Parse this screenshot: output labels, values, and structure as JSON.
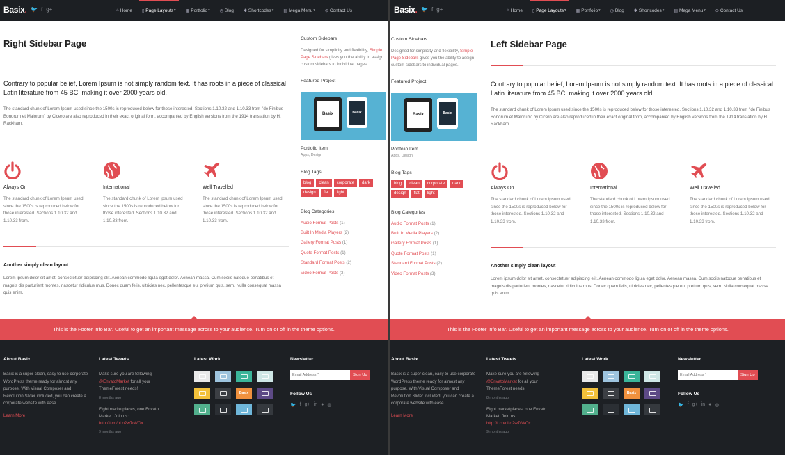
{
  "colors": {
    "accent": "#e14d53",
    "nav_bg": "#1c1f23",
    "footer_bg": "#1d2024",
    "project_bg": "#56b2d3"
  },
  "header": {
    "logo": "Basix",
    "logo_dot": ".",
    "social_icons": [
      "twitter-icon",
      "facebook-icon",
      "google-plus-icon"
    ],
    "social_glyphs": [
      "🐦",
      "f",
      "g+"
    ],
    "nav": [
      {
        "icon": "home-icon",
        "glyph": "⌂",
        "label": "Home"
      },
      {
        "icon": "page-icon",
        "glyph": "▯",
        "label": "Page Layouts"
      },
      {
        "icon": "portfolio-icon",
        "glyph": "▦",
        "label": "Portfolio"
      },
      {
        "icon": "blog-icon",
        "glyph": "◷",
        "label": "Blog"
      },
      {
        "icon": "shortcodes-icon",
        "glyph": "✱",
        "label": "Shortcodes"
      },
      {
        "icon": "mega-menu-icon",
        "glyph": "▤",
        "label": "Mega Menu"
      },
      {
        "icon": "contact-icon",
        "glyph": "⊙",
        "label": "Contact Us"
      }
    ],
    "caret": "▾"
  },
  "pages": {
    "right": {
      "title": "Right Sidebar Page"
    },
    "left": {
      "title": "Left Sidebar Page"
    }
  },
  "content": {
    "lead": "Contrary to popular belief, Lorem Ipsum is not simply random text. It has roots in a piece of classical Latin literature from 45 BC, making it over 2000 years old.",
    "paragraph": "The standard chunk of Lorem Ipsum used since the 1500s is reproduced below for those interested. Sections 1.10.32 and 1.10.33 from \"de Finibus Bonorum et Malorum\" by Cicero are also reproduced in their exact original form, accompanied by English versions from the 1914 translation by H. Rackham.",
    "features": [
      {
        "icon": "power-icon",
        "title": "Always On",
        "text": "The standard chunk of Lorem Ipsum used since the 1500s is reproduced below for those interested. Sections 1.10.32 and 1.10.33 from."
      },
      {
        "icon": "globe-icon",
        "title": "International",
        "text": "The standard chunk of Lorem Ipsum used since the 1500s is reproduced below for those interested. Sections 1.10.32 and 1.10.33 from."
      },
      {
        "icon": "plane-icon",
        "title": "Well Travelled",
        "text": "The standard chunk of Lorem Ipsum used since the 1500s is reproduced below for those interested. Sections 1.10.32 and 1.10.33 from."
      }
    ],
    "layout_title": "Another simply clean layout",
    "layout_text": "Lorem ipsum dolor sit amet, consectetuer adipiscing elit. Aenean commodo ligula eget dolor. Aenean massa. Cum sociis natoque penatibus et magnis dis parturient montes, nascetur ridiculus mus. Donec quam felis, ultricies nec, pellentesque eu, pretium quis, sem. Nulla consequat massa quis enim."
  },
  "sidebar": {
    "custom_title": "Custom Sidebars",
    "custom_text_before": "Designed for simplicity and flexibility,",
    "custom_link": "Simple Page Sidebars",
    "custom_text_after": "gives you the ability to assign custom sidebars to individual pages.",
    "featured_title": "Featured Project",
    "project_tablet_left": "Basix",
    "project_tablet_right": "Basix",
    "project_name": "Portfolio Item",
    "project_cats": "Apps, Design",
    "tags_title": "Blog Tags",
    "tags": [
      "blog",
      "clean",
      "corporate",
      "dark",
      "design",
      "flat",
      "light"
    ],
    "categories_title": "Blog Categories",
    "categories": [
      {
        "name": "Audio Format Posts",
        "count": "(1)"
      },
      {
        "name": "Built In Media Players",
        "count": "(2)"
      },
      {
        "name": "Gallery Format Posts",
        "count": "(1)"
      },
      {
        "name": "Quote Format Posts",
        "count": "(1)"
      },
      {
        "name": "Standard Format Posts",
        "count": "(2)"
      },
      {
        "name": "Video Format Posts",
        "count": "(3)"
      }
    ]
  },
  "info_bar": "This is the Footer Info Bar. Useful to get an important message across to your audience. Turn on or off in the theme options.",
  "footer": {
    "about_title": "About Basix",
    "about_text": "Basix is a super clean, easy to use corporate WordPress theme ready for almost any purpose. With Visual Composer and Revolution Slider included, you can create a corporate website with ease.",
    "learn_more": "Learn More",
    "tweets_title": "Latest Tweets",
    "tweet1_text": "Make sure you are following",
    "tweet1_link": "@EnvatoMarket",
    "tweet1_after": "for all your ThemeForest needs!",
    "tweet1_time": "8 months ago",
    "tweet2_text": "Eight marketplaces, one Envato Market. Join us:",
    "tweet2_link": "http://t.co/oLo2w7rWOx",
    "tweet2_time": "9 months ago",
    "work_title": "Latest Work",
    "work_items": [
      {
        "icon": "red-tablet-icon",
        "color": "#e9e9e9"
      },
      {
        "icon": "pattern-icon",
        "color": "#9ec4de"
      },
      {
        "icon": "monitor-icon",
        "color": "#3bb59a"
      },
      {
        "icon": "compass-icon",
        "color": "#cfe7e6"
      },
      {
        "icon": "tag-icon",
        "color": "#f3c13a"
      },
      {
        "icon": "glasses-icon",
        "color": "#3c3f44"
      },
      {
        "icon": "basix-logo-icon",
        "color": "#f0913e",
        "text": "Basix"
      },
      {
        "icon": "circles-icon",
        "color": "#5d4a86"
      },
      {
        "icon": "phone-icon",
        "color": "#52b08d"
      },
      {
        "icon": "hexagon-icon",
        "color": "#2b2f34"
      },
      {
        "icon": "window-icon",
        "color": "#6fb6d9"
      },
      {
        "icon": "dots-icon",
        "color": "#35393e"
      }
    ],
    "newsletter_title": "Newsletter",
    "email_placeholder": "Email Address *",
    "signup": "Sign Up",
    "follow_title": "Follow Us",
    "follow_icons": [
      "twitter-icon",
      "facebook-icon",
      "google-plus-icon",
      "linkedin-icon",
      "flickr-icon",
      "dribbble-icon"
    ],
    "follow_glyphs": [
      "🐦",
      "f",
      "g+",
      "in",
      "●",
      "◍"
    ]
  }
}
